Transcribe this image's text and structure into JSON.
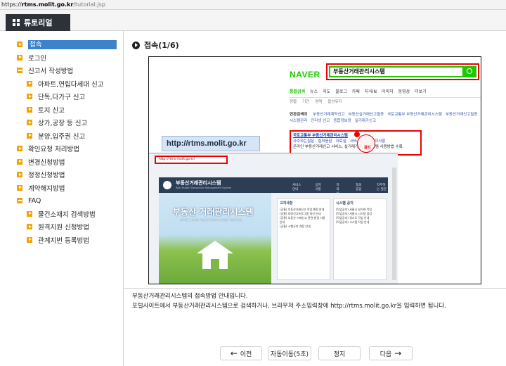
{
  "browser": {
    "url_scheme": "https://",
    "url_host": "rtms.molit.go.kr",
    "url_path": "/tutorial.jsp"
  },
  "header": {
    "tab_label": "튜토리얼"
  },
  "sidebar": {
    "items": [
      {
        "label": "접속",
        "marker": "arrow",
        "level": 1,
        "active": true
      },
      {
        "label": "로그인",
        "marker": "arrow",
        "level": 1,
        "active": false
      },
      {
        "label": "신고서 작성방법",
        "marker": "minus",
        "level": 1,
        "active": false
      },
      {
        "label": "아파트,연립다세대 신고",
        "marker": "arrow",
        "level": 2,
        "active": false
      },
      {
        "label": "단독,다가구 신고",
        "marker": "arrow",
        "level": 2,
        "active": false
      },
      {
        "label": "토지 신고",
        "marker": "arrow",
        "level": 2,
        "active": false
      },
      {
        "label": "상가,공장 등 신고",
        "marker": "arrow",
        "level": 2,
        "active": false
      },
      {
        "label": "분양,입주권 신고",
        "marker": "arrow",
        "level": 2,
        "active": false
      },
      {
        "label": "확인요청 처리방법",
        "marker": "arrow",
        "level": 1,
        "active": false
      },
      {
        "label": "변경신청방법",
        "marker": "arrow",
        "level": 1,
        "active": false
      },
      {
        "label": "정정신청방법",
        "marker": "arrow",
        "level": 1,
        "active": false
      },
      {
        "label": "계약해지방법",
        "marker": "arrow",
        "level": 1,
        "active": false
      },
      {
        "label": "FAQ",
        "marker": "minus",
        "level": 1,
        "active": false
      },
      {
        "label": "물건소재지 검색방법",
        "marker": "arrow",
        "level": 2,
        "active": false
      },
      {
        "label": "원격지원 신청방법",
        "marker": "arrow",
        "level": 2,
        "active": false
      },
      {
        "label": "관계지번 등록방법",
        "marker": "arrow",
        "level": 2,
        "active": false
      }
    ]
  },
  "main": {
    "step_title": "접속(1/6)",
    "description_line1": "부동산거래관리시스템의 접속방법 안내입니다.",
    "description_line2": "포털사이트에서 부동산거래관리시스템으로 검색하거나, 브라우저 주소입력창에 http://rtms.molit.go.kr을 입력하면 됩니다.",
    "screenshot": {
      "naver_logo": "NAVER",
      "search_query": "부동산거래관리시스템",
      "naver_tabs": [
        "통합검색",
        "뉴스",
        "지도",
        "블로그",
        "카페",
        "지식iN",
        "이미지",
        "동영상",
        "더보기"
      ],
      "naver_tools": [
        "정렬",
        "기간",
        "영역",
        "옵션유지"
      ],
      "related_label": "연관검색어",
      "related_links": [
        "부동산거래계약신고",
        "부동산실거래신고필증",
        "국토교통부 부동산거래관리시스템",
        "부동산거래신고필증",
        "시스템관리",
        "인터넷 신고",
        "종합정보망",
        "실거래가신고"
      ],
      "result_title": "국토교통부 부동산거래관리시스템",
      "result_links": [
        "자주하는질문",
        "질의응답",
        "자료실",
        "서비스소개",
        "공지사항"
      ],
      "result_snippet": "온라인 부동산거래신고 서비스, 실거래가 신고 시스템 사용방법 수록.",
      "click_label": "클릭",
      "url_callout": "http://rtms.molit.go.kr",
      "inner_address": "http://rtms.molit.go.kr/",
      "rtms_title": "부동산거래관리시스템",
      "rtms_subtitle": "Real Estate Transaction Management System",
      "rtms_menu": [
        "서비스안내",
        "공지사항",
        "자료실",
        "질의응답",
        "자주하는 질문"
      ],
      "hero_title": "부동산 거래관리시스템",
      "hero_subtitle": "편리하고 안전한 부동산거래관리시스템을 이용하세요.",
      "notice_head": "고지사항",
      "system_head": "시스템 공지",
      "notice_items": [
        "(공통) 부동산거래신고 작업 예정 안내",
        "(공통) 대량신고프로그램 개선 안내",
        "(공통) 부동산 거래신고 관련 변경 사항 안내",
        "(공통) 시행규칙 개정 안내"
      ],
      "system_items": [
        "(작업공지) 서울시 실거래 작업",
        "(작업공지) 서울시 시스템 점검",
        "(작업공지) 경기도 작업 안내",
        "(작업공지) 시스템 작업 안내"
      ]
    }
  },
  "controls": {
    "prev_label": "이전",
    "auto_label": "자동이동(5초)",
    "stop_label": "정지",
    "next_label": "다음"
  },
  "colors": {
    "sidebar_marker": "#f2a400",
    "active_item": "#3d83c9",
    "header_tab": "#2d3238",
    "naver_green": "#1ec800",
    "highlight_red": "#ee0000"
  }
}
